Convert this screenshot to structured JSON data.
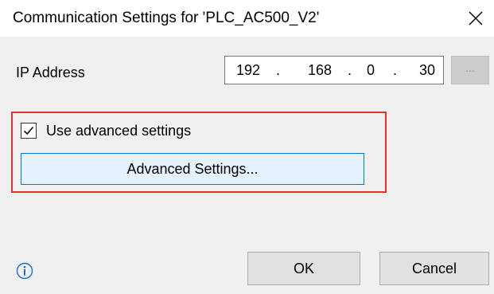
{
  "window": {
    "title": "Communication Settings for 'PLC_AC500_V2'",
    "close_glyph": "×"
  },
  "ip": {
    "label": "IP Address",
    "octets": [
      "192",
      "168",
      "0",
      "30"
    ],
    "separator": ".",
    "browse_label": "..."
  },
  "advanced": {
    "checkbox_label": "Use advanced settings",
    "checked": true,
    "button_label": "Advanced Settings...",
    "frame_color": "#e8322e"
  },
  "footer": {
    "info_icon": "info-circle-icon",
    "ok_label": "OK",
    "cancel_label": "Cancel"
  },
  "colors": {
    "accent": "#0078d7",
    "info": "#1a6fd1",
    "client_background": "#f0f0f0"
  }
}
